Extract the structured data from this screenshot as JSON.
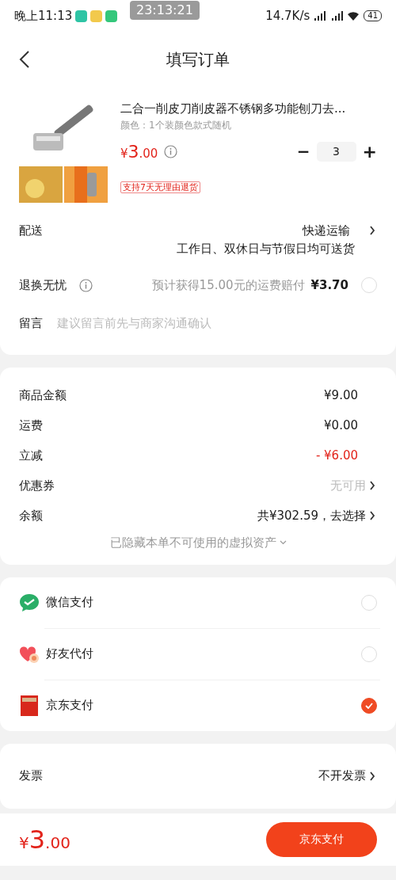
{
  "status_bar": {
    "time": "晚上11:13",
    "recorder": "23:13:21",
    "speed": "14.7K/s",
    "battery": "41"
  },
  "header": {
    "title": "填写订单"
  },
  "product": {
    "name": "二合一削皮刀削皮器不锈钢多功能刨刀去...",
    "spec": "颜色：1个装颜色款式随机",
    "price": {
      "currency": "¥",
      "integer": "3",
      "decimal": ".00"
    },
    "quantity": "3",
    "minus": "−",
    "plus": "+",
    "tag": "支持7天无理由退货"
  },
  "delivery": {
    "label": "配送",
    "method": "快递运输",
    "note": "工作日、双休日与节假日均可送货"
  },
  "return_insurance": {
    "label": "退换无忧",
    "description": "预计获得15.00元的运费赔付",
    "price": "¥3.70",
    "checked": false
  },
  "message": {
    "label": "留言",
    "placeholder": "建议留言前先与商家沟通确认"
  },
  "summary": [
    {
      "label": "商品金额",
      "value": "¥9.00",
      "kind": "amount"
    },
    {
      "label": "运费",
      "value": "¥0.00",
      "kind": "amount"
    },
    {
      "label": "立减",
      "value": "- ¥6.00",
      "kind": "discount"
    },
    {
      "label": "优惠券",
      "value": "无可用",
      "kind": "muted-link"
    },
    {
      "label": "余额",
      "value": "共¥302.59，去选择",
      "kind": "link"
    }
  ],
  "hidden_assets": "已隐藏本单不可使用的虚拟资产",
  "payment_methods": [
    {
      "name": "微信支付",
      "kind": "wechat",
      "selected": false
    },
    {
      "name": "好友代付",
      "kind": "friend",
      "selected": false
    },
    {
      "name": "京东支付",
      "kind": "card",
      "selected": true
    }
  ],
  "invoice": {
    "label": "发票",
    "value": "不开发票"
  },
  "footer": {
    "total": {
      "currency": "¥",
      "integer": "3",
      "decimal": ".00"
    },
    "button": "京东支付"
  }
}
